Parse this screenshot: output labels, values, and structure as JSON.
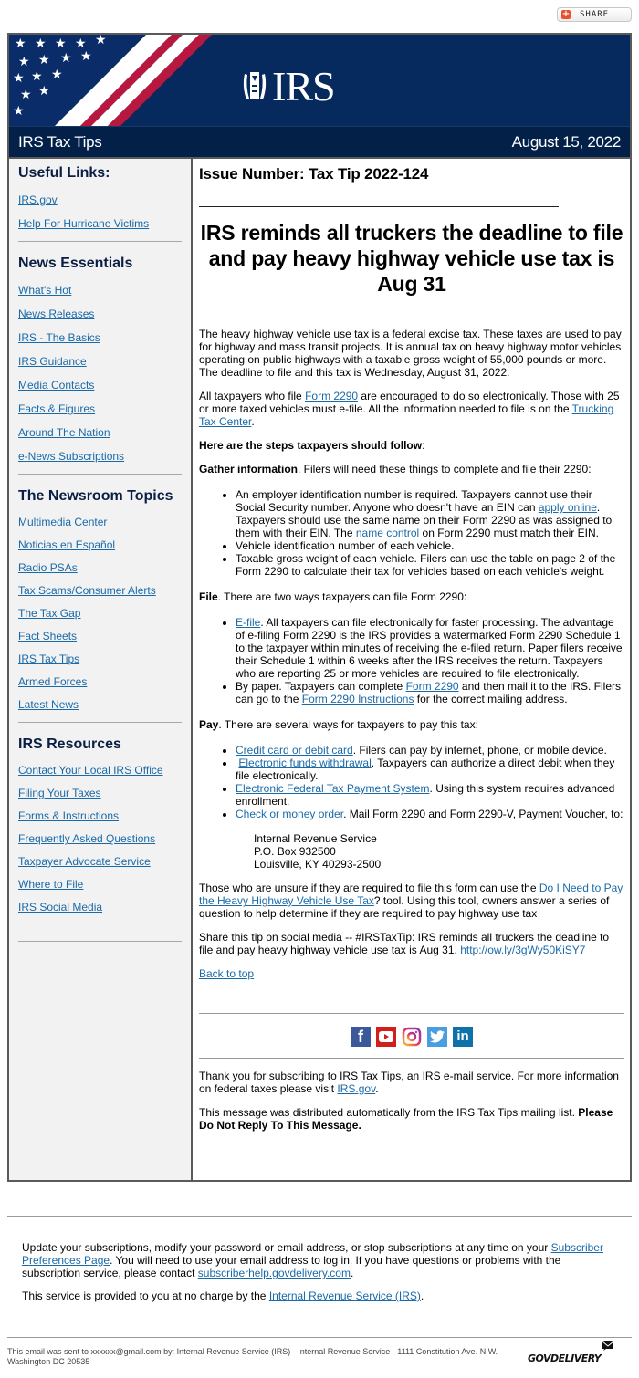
{
  "share": {
    "label": "SHARE"
  },
  "banner": {
    "logo_text": "IRS"
  },
  "titlebar": {
    "title": "IRS Tax Tips",
    "date": "August 15, 2022"
  },
  "sidebar": {
    "sections": [
      {
        "title": "Useful Links:",
        "links": [
          "IRS.gov",
          "Help For Hurricane Victims"
        ]
      },
      {
        "title": "News Essentials",
        "links": [
          "What's Hot",
          "News Releases",
          "IRS - The Basics",
          "IRS Guidance",
          "Media Contacts",
          "Facts & Figures",
          "Around The Nation",
          "e-News Subscriptions"
        ]
      },
      {
        "title": "The Newsroom Topics",
        "links": [
          "Multimedia Center",
          "Noticias en Español",
          "Radio PSAs",
          "Tax Scams/Consumer Alerts",
          "The Tax Gap",
          "Fact Sheets",
          "IRS Tax Tips",
          "Armed Forces",
          "Latest News"
        ]
      },
      {
        "title": "IRS Resources",
        "links": [
          "Contact Your Local IRS Office",
          "Filing Your Taxes",
          "Forms & Instructions",
          "Frequently Asked Questions",
          "Taxpayer Advocate Service",
          "Where to File",
          "IRS Social Media"
        ]
      }
    ]
  },
  "main": {
    "issue": "Issue Number: Tax Tip 2022-124",
    "headline": "IRS reminds all truckers the deadline to file and pay heavy highway vehicle use tax is Aug 31",
    "intro": "The heavy highway vehicle use tax is a federal excise tax. These taxes are used to pay for highway and mass transit projects. It is annual tax on heavy highway motor vehicles operating on public highways with a taxable gross weight of 55,000 pounds or more. The deadline to file and this tax is Wednesday, August 31, 2022.",
    "efile_para": {
      "pre": "All taxpayers who file ",
      "link1": "Form 2290",
      "mid": " are encouraged to do so electronically. Those with 25 or more taxed vehicles must e-file. All the information needed to file is on the ",
      "link2": "Trucking Tax Center",
      "post": "."
    },
    "steps_heading": "Here are the steps taxpayers should follow",
    "steps_colon": ":",
    "gather": {
      "label": "Gather information",
      "text": ". Filers will need these things to complete and file their 2290:",
      "items": [
        {
          "pre": "An employer identification number is required. Taxpayers cannot use their Social Security number. Anyone who doesn't have an EIN can ",
          "link1": "apply online",
          "mid": ". Taxpayers should use the same name on their Form 2290 as was assigned to them with their EIN. The ",
          "link2": "name control",
          "post": " on Form 2290 must match their EIN."
        },
        {
          "text": "Vehicle identification number of each vehicle."
        },
        {
          "text": "Taxable gross weight of each vehicle. Filers can use the table on page 2 of the Form 2290 to calculate their tax for vehicles based on each vehicle's weight."
        }
      ]
    },
    "file": {
      "label": "File",
      "text": ". There are two ways taxpayers can file Form 2290:",
      "items": [
        {
          "link": "E-file",
          "post": ". All taxpayers can file electronically for faster processing. The advantage of e-filing Form 2290 is the IRS provides a watermarked Form 2290 Schedule 1 to the taxpayer within minutes of receiving the e-filed return. Paper filers receive their Schedule 1 within 6 weeks after the IRS receives the return. Taxpayers who are reporting 25 or more vehicles are required to file electronically."
        },
        {
          "pre": "By paper. Taxpayers can complete ",
          "link1": "Form 2290",
          "mid": " and then mail it to the IRS. Filers can go to the ",
          "link2": "Form 2290 Instructions",
          "post": " for the correct mailing address."
        }
      ]
    },
    "pay": {
      "label": "Pay",
      "text": ". There are several ways for taxpayers to pay this tax:",
      "items": [
        {
          "link": "Credit card or debit card",
          "post": ". Filers can pay by internet, phone, or mobile device."
        },
        {
          "link": "Electronic funds withdrawal",
          "post": ". Taxpayers can authorize a direct debit when they file electronically."
        },
        {
          "link": "Electronic Federal Tax Payment System",
          "post": ". Using this system requires advanced enrollment."
        },
        {
          "link": "Check or money order",
          "post": ". Mail Form 2290 and Form 2290-V, Payment Voucher, to:"
        }
      ],
      "address": [
        "Internal Revenue Service",
        "P.O. Box 932500",
        "Louisville, KY 40293-2500"
      ]
    },
    "unsure": {
      "pre": "Those who are unsure if they are required to file this form can use the ",
      "link": "Do I Need to Pay the Heavy Highway Vehicle Use Tax",
      "post": "? tool. Using this tool, owners answer a series of question to help determine if they are required to pay highway use tax"
    },
    "share_tip": {
      "pre": "Share this tip on social media -- #IRSTaxTip: IRS reminds all truckers the deadline to file and pay heavy highway vehicle use tax is Aug 31. ",
      "link": "http://ow.ly/3gWy50KiSY7"
    },
    "back_to_top": "Back to top",
    "social_icons": [
      "facebook-icon",
      "youtube-icon",
      "instagram-icon",
      "twitter-icon",
      "linkedin-icon"
    ],
    "thanks": {
      "pre": "Thank you for subscribing to IRS Tax Tips, an IRS e-mail service. For more information on federal taxes please visit ",
      "link": "IRS.gov",
      "post": "."
    },
    "auto_msg": {
      "pre": "This message was distributed automatically from the IRS Tax Tips mailing list. ",
      "bold": "Please Do Not Reply To This Message."
    }
  },
  "footer": {
    "update": {
      "pre": "Update your subscriptions, modify your password or email address, or stop subscriptions at any time on your ",
      "link1": "Subscriber Preferences Page",
      "mid": ". You will need to use your email address to log in. If you have questions or problems with the subscription service, please contact ",
      "link2": "subscriberhelp.govdelivery.com",
      "post": "."
    },
    "service": {
      "pre": "This service is provided to you at no charge by the ",
      "link": "Internal Revenue Service (IRS)",
      "post": "."
    },
    "sent_to": "This email was sent to xxxxxx@gmail.com by: Internal Revenue Service (IRS) · Internal Revenue Service · 1111 Constitution Ave. N.W. · Washington DC 20535",
    "brand": "GOVDELIVERY"
  },
  "colors": {
    "banner": "#062a5e",
    "titlebar": "#022048",
    "link": "#1a6aa8",
    "sidebar_bg": "#f2f2f2",
    "heading": "#0b1f45"
  }
}
